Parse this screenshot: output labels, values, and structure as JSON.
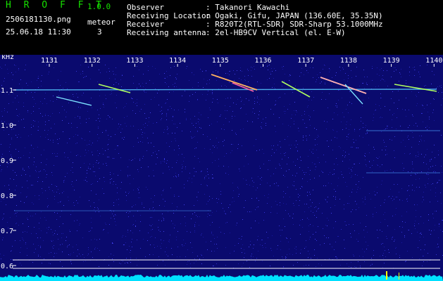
{
  "header": {
    "brand": "H R O F F T",
    "version": "1.0.0",
    "filename": "2506181130.png",
    "datetime": "25.06.18 11:30",
    "meteor_label": "meteor",
    "meteor_count": "3",
    "fields": [
      {
        "label": "Observer",
        "value": ": Takanori Kawachi"
      },
      {
        "label": "Receiving Location",
        "value": ": Ogaki, Gifu, JAPAN (136.60E, 35.35N)"
      },
      {
        "label": "Receiver",
        "value": ": R820T2(RTL-SDR) SDR-Sharp 53.1000MHz"
      },
      {
        "label": "Receiving antenna",
        "value": ": 2el-HB9CV Vertical (el. E-W)"
      }
    ]
  },
  "plot": {
    "y_unit": "kHz",
    "y_ticks": [
      "1.1",
      "1.0",
      "0.9",
      "0.8",
      "0.7",
      "0.6"
    ],
    "x_ticks": [
      "1131",
      "1132",
      "1133",
      "1134",
      "1135",
      "1136",
      "1137",
      "1138",
      "1139",
      "1140"
    ],
    "colors": {
      "background": "#0a0a6e",
      "trace": "#00e0ff",
      "marker": "#ffff00"
    }
  }
}
